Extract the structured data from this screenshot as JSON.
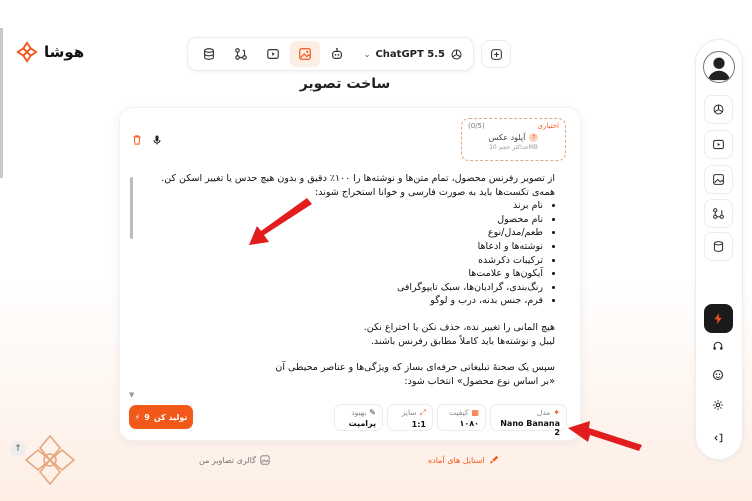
{
  "brand": {
    "name": "هوشا"
  },
  "toolbar": {
    "tools": [
      {
        "name": "database-icon"
      },
      {
        "name": "workflow-icon"
      },
      {
        "name": "video-icon"
      },
      {
        "name": "image-generate-icon",
        "active": true
      },
      {
        "name": "robot-icon"
      }
    ],
    "model_label": "ChatGPT 5.5",
    "new_chat_icon": "plus-square-icon"
  },
  "page": {
    "title": "ساخت تصویر"
  },
  "upload": {
    "count": "(0/5)",
    "optional": "اختیاری",
    "label": "آپلود عکس",
    "hint": "حداکثر حجم 10MB"
  },
  "prompt": {
    "intro_1": "از تصویر رفرنس محصول، تمام متن‌ها و نوشته‌ها را ۱۰۰٪ دقیق و بدون هیچ حدس یا تغییر اسکن کن.",
    "intro_2": "همه‌ی تکست‌ها باید به صورت فارسی و خوانا استخراج شوند:",
    "items": [
      "نام برند",
      "نام محصول",
      "طعم/مدل/نوع",
      "نوشته‌ها و ادعاها",
      "ترکیبات ذکرشده",
      "آیکون‌ها و علامت‌ها",
      "رنگ‌بندی، گرادیان‌ها، سبک تایپوگرافی",
      "فرم، جنس بدنه، درب و لوگو"
    ],
    "para_2a": "هیچ المانی را تغییر نده، حذف نکن یا اختراع نکن.",
    "para_2b": "لیبل و نوشته‌ها باید کاملاً مطابق رفرنس باشند.",
    "para_3a": "سپس یک صحنهٔ تبلیغاتی حرفه‌ای بساز که ویژگی‌ها و عناصر محیطی آن",
    "para_3b": "«بر اساس نوع محصول» انتخاب شود:"
  },
  "options": {
    "model": {
      "label": "مدل",
      "value": "Nano Banana 2"
    },
    "quality": {
      "label": "کیفیت",
      "value": "۱۰۸۰"
    },
    "size": {
      "label": "سایز",
      "value": "1:1"
    },
    "enhance": {
      "label": "بهبود",
      "value": "پرامپت"
    }
  },
  "generate": {
    "label": "تولید کن",
    "cost": "9"
  },
  "links": {
    "styles": "استایل های آماده",
    "gallery": "گالری تصاویر من"
  },
  "colors": {
    "accent": "#f2581a",
    "accent_soft": "#fdeee4",
    "arrow": "#e11d1d"
  }
}
